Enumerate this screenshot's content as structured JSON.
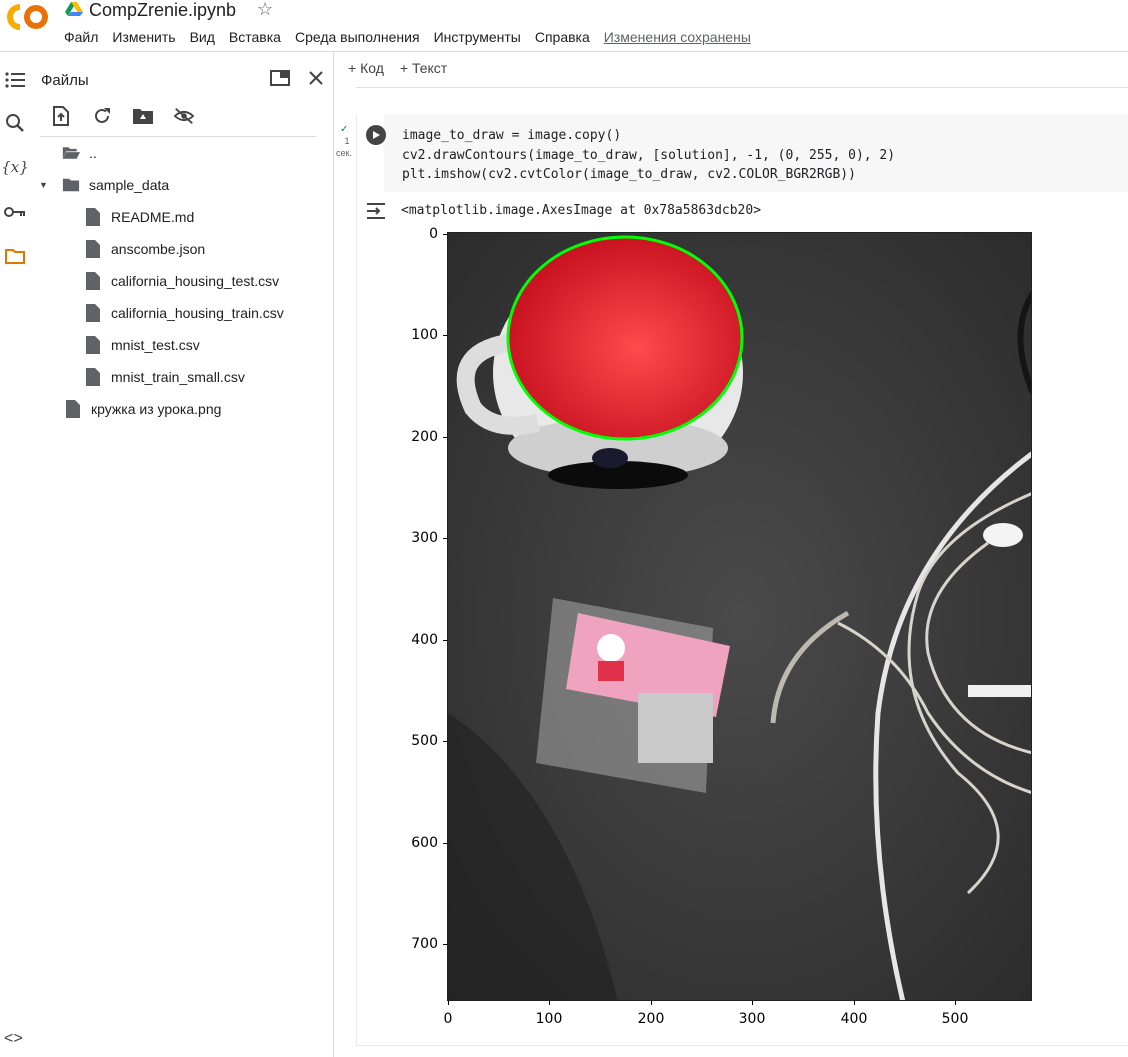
{
  "header": {
    "filename": "CompZrenie.ipynb",
    "logo_text": "CO",
    "menu": [
      "Файл",
      "Изменить",
      "Вид",
      "Вставка",
      "Среда выполнения",
      "Инструменты",
      "Справка"
    ],
    "saved_status": "Изменения сохранены"
  },
  "files_panel": {
    "title": "Файлы",
    "items": [
      {
        "label": "..",
        "type": "folder-open",
        "indent": 0
      },
      {
        "label": "sample_data",
        "type": "folder",
        "indent": 0
      },
      {
        "label": "README.md",
        "type": "file",
        "indent": 1
      },
      {
        "label": "anscombe.json",
        "type": "file",
        "indent": 1
      },
      {
        "label": "california_housing_test.csv",
        "type": "file",
        "indent": 1
      },
      {
        "label": "california_housing_train.csv",
        "type": "file",
        "indent": 1
      },
      {
        "label": "mnist_test.csv",
        "type": "file",
        "indent": 1
      },
      {
        "label": "mnist_train_small.csv",
        "type": "file",
        "indent": 1
      },
      {
        "label": "кружка из урока.png",
        "type": "file",
        "indent": 0
      }
    ]
  },
  "notebook": {
    "add_code": "Код",
    "add_text": "Текст",
    "cell": {
      "exec_count": "1",
      "exec_time": "сек.",
      "code_lines": [
        "image_to_draw = image.copy()",
        "cv2.drawContours(image_to_draw, [solution], -1, (0, 255, 0), 2)",
        "plt.imshow(cv2.cvtColor(image_to_draw, cv2.COLOR_BGR2RGB))"
      ],
      "output_text": "<matplotlib.image.AxesImage at 0x78a5863dcb20>"
    }
  },
  "plot": {
    "y_ticks": [
      "0",
      "100",
      "200",
      "300",
      "400",
      "500",
      "600",
      "700"
    ],
    "x_ticks": [
      "0",
      "100",
      "200",
      "300",
      "400",
      "500"
    ],
    "contour_color": "#00ff00"
  },
  "colors": {
    "accent_orange": "#f9ab00",
    "folder_active": "#e37400"
  }
}
